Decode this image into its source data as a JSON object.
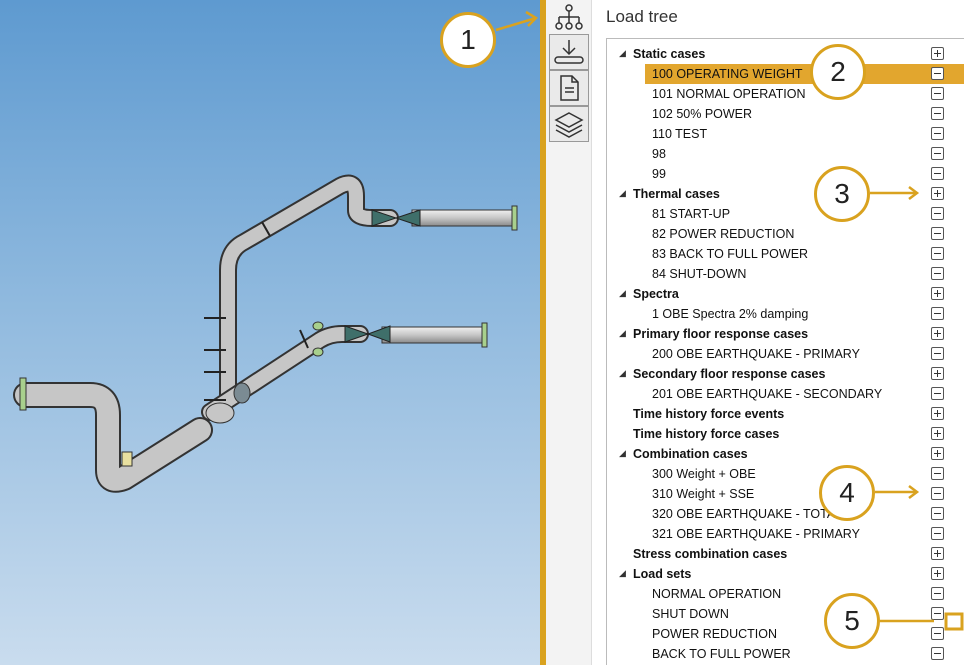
{
  "panel": {
    "title": "Load tree"
  },
  "tabs": [
    {
      "name": "load-tree-tab",
      "icon": "hierarchy-icon"
    },
    {
      "name": "import-tab",
      "icon": "download-icon"
    },
    {
      "name": "document-tab",
      "icon": "document-icon"
    },
    {
      "name": "layers-tab",
      "icon": "layers-icon"
    }
  ],
  "tree": [
    {
      "type": "group",
      "label": "Static cases",
      "expanded": true,
      "toggle": "plus"
    },
    {
      "type": "item",
      "label": "100 OPERATING WEIGHT",
      "selected": true,
      "toggle": "minus"
    },
    {
      "type": "item",
      "label": "101 NORMAL OPERATION",
      "toggle": "minus"
    },
    {
      "type": "item",
      "label": "102 50% POWER",
      "toggle": "minus"
    },
    {
      "type": "item",
      "label": "110 TEST",
      "toggle": "minus"
    },
    {
      "type": "item",
      "label": "98",
      "toggle": "minus"
    },
    {
      "type": "item",
      "label": "99",
      "toggle": "minus"
    },
    {
      "type": "group",
      "label": "Thermal cases",
      "expanded": true,
      "toggle": "plus"
    },
    {
      "type": "item",
      "label": "81 START-UP",
      "toggle": "minus"
    },
    {
      "type": "item",
      "label": "82 POWER REDUCTION",
      "toggle": "minus"
    },
    {
      "type": "item",
      "label": "83 BACK TO FULL POWER",
      "toggle": "minus"
    },
    {
      "type": "item",
      "label": "84 SHUT-DOWN",
      "toggle": "minus"
    },
    {
      "type": "group",
      "label": "Spectra",
      "expanded": true,
      "toggle": "plus"
    },
    {
      "type": "item",
      "label": "1 OBE Spectra 2% damping",
      "toggle": "minus"
    },
    {
      "type": "group",
      "label": "Primary floor response cases",
      "expanded": true,
      "toggle": "plus"
    },
    {
      "type": "item",
      "label": "200 OBE EARTHQUAKE - PRIMARY",
      "toggle": "minus"
    },
    {
      "type": "group",
      "label": "Secondary floor response cases",
      "expanded": true,
      "toggle": "plus"
    },
    {
      "type": "item",
      "label": "201 OBE EARTHQUAKE - SECONDARY",
      "toggle": "minus"
    },
    {
      "type": "group",
      "label": "Time history force events",
      "expanded": false,
      "toggle": "plus"
    },
    {
      "type": "group",
      "label": "Time history force cases",
      "expanded": false,
      "toggle": "plus"
    },
    {
      "type": "group",
      "label": "Combination cases",
      "expanded": true,
      "toggle": "plus"
    },
    {
      "type": "item",
      "label": "300 Weight + OBE",
      "toggle": "minus"
    },
    {
      "type": "item",
      "label": "310 Weight + SSE",
      "toggle": "minus"
    },
    {
      "type": "item",
      "label": "320 OBE EARTHQUAKE - TOTAL",
      "toggle": "minus"
    },
    {
      "type": "item",
      "label": "321 OBE EARTHQUAKE - PRIMARY",
      "toggle": "minus"
    },
    {
      "type": "group",
      "label": "Stress combination cases",
      "expanded": false,
      "toggle": "plus"
    },
    {
      "type": "group",
      "label": "Load sets",
      "expanded": true,
      "toggle": "plus"
    },
    {
      "type": "item",
      "label": "NORMAL OPERATION",
      "toggle": "minus"
    },
    {
      "type": "item",
      "label": "SHUT DOWN",
      "toggle": "minus"
    },
    {
      "type": "item",
      "label": "POWER REDUCTION",
      "toggle": "minus"
    },
    {
      "type": "item",
      "label": "BACK TO FULL POWER",
      "toggle": "minus"
    }
  ],
  "callouts": [
    "1",
    "2",
    "3",
    "4",
    "5"
  ],
  "colors": {
    "accent": "#d9a21f",
    "selection": "#e2a62e",
    "pipe": "#c8c8c8",
    "flange": "#a8d08d",
    "valve": "#3f6f6a"
  }
}
